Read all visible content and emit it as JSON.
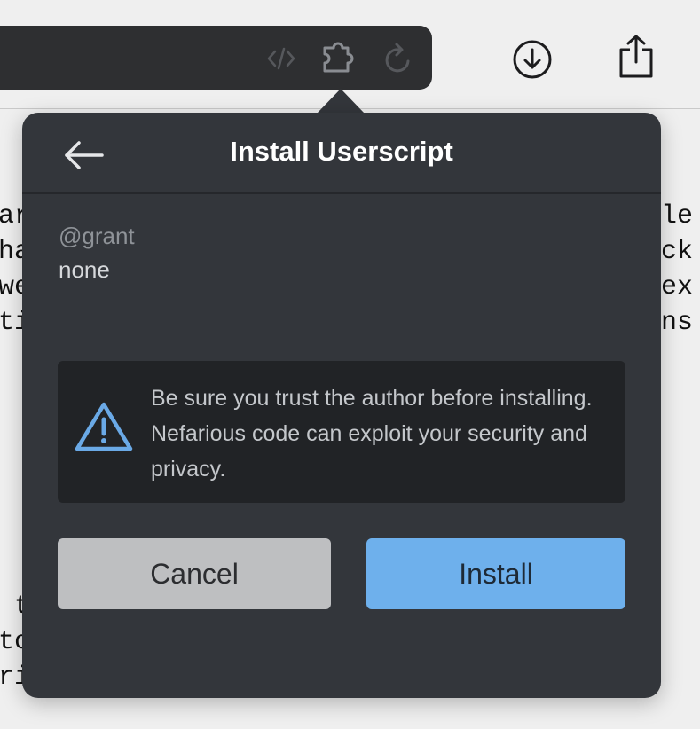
{
  "page_text_fragments": {
    "left": [
      "ar",
      "ha",
      "we",
      "ti"
    ],
    "right": [
      "le",
      "ck",
      "ex",
      "ns"
    ],
    "bottom_left": [
      " t",
      "to",
      "ri"
    ]
  },
  "popover": {
    "title": "Install Userscript",
    "meta_key": "@grant",
    "meta_value": "none",
    "warning": "Be sure you trust the author before installing. Nefarious code can exploit your security and privacy.",
    "cancel_label": "Cancel",
    "install_label": "Install"
  },
  "colors": {
    "popover_bg": "#33363b",
    "warning_accent": "#6aa9e6",
    "install_button": "#6eb0ec",
    "cancel_button": "#bebfc1"
  }
}
